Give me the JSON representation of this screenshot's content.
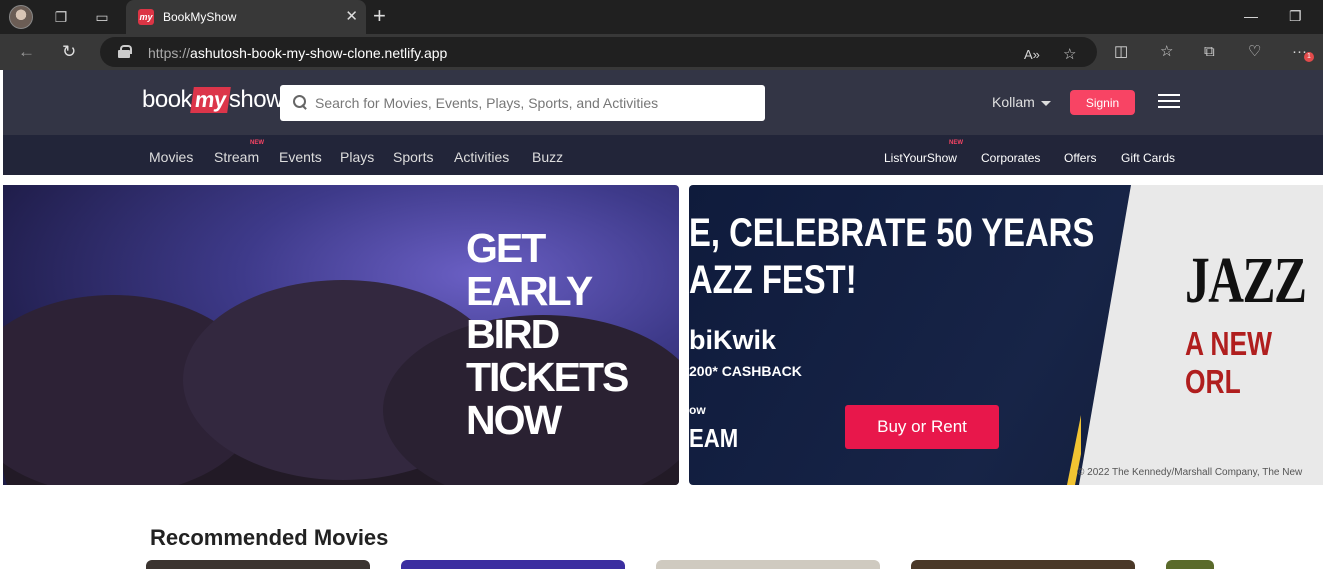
{
  "browser": {
    "tab_title": "BookMyShow",
    "tab_favicon": "my",
    "url_protocol": "https://",
    "url_host": "ashutosh-book-my-show-clone.netlify.app",
    "extension_badge": "1"
  },
  "site": {
    "logo": {
      "part1": "book",
      "part2": "my",
      "part3": "show"
    },
    "search_placeholder": "Search for Movies, Events, Plays, Sports, and Activities",
    "city": "Kollam",
    "signin_label": "Signin",
    "nav_left": [
      "Movies",
      "Stream",
      "Events",
      "Plays",
      "Sports",
      "Activities",
      "Buzz"
    ],
    "nav_right": [
      "ListYourShow",
      "Corporates",
      "Offers",
      "Gift Cards"
    ],
    "new_tag": "NEW",
    "colors": {
      "header": "#333545",
      "subnav": "#222539",
      "accent": "#f84464"
    }
  },
  "banner1": {
    "lines": [
      "GET",
      "EARLY",
      "BIRD",
      "TICKETS",
      "NOW"
    ]
  },
  "banner2": {
    "headline_line1": "E, CELEBRATE 50 YEARS",
    "headline_line2": "AZZ FEST!",
    "brand": "biKwik",
    "cashback": "200* CASHBACK",
    "now": "ow",
    "team": "EAM",
    "button": "Buy or Rent",
    "jazz": "JAZZ",
    "new_orleans": "A NEW ORL",
    "copyright": "© 2022 The Kennedy/Marshall Company, The New"
  },
  "recommended_title": "Recommended Movies"
}
